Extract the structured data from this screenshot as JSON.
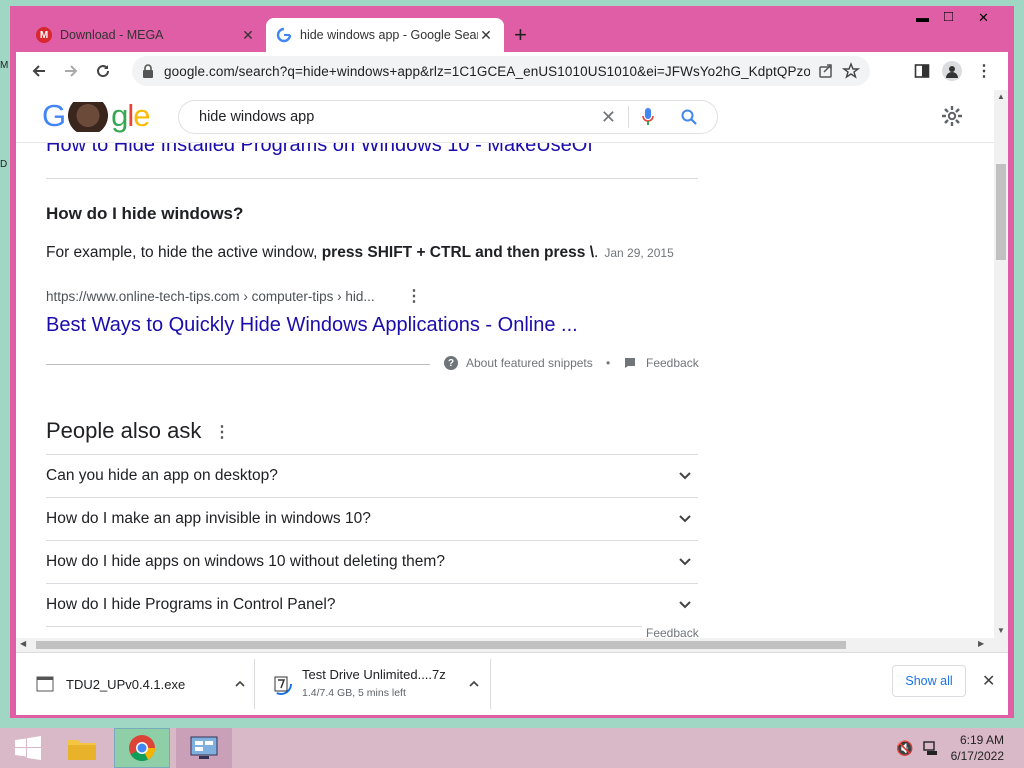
{
  "desktop": {
    "left_chars": [
      "M",
      "D"
    ]
  },
  "browser": {
    "tabs": [
      {
        "title": "Download - MEGA",
        "favicon": "mega-icon",
        "active": false
      },
      {
        "title": "hide windows app - Google Sear",
        "favicon": "google-icon",
        "active": true
      }
    ],
    "window_controls": {
      "minimize": "▬",
      "maximize": "□",
      "close": "✕"
    },
    "address": "google.com/search?q=hide+windows+app&rlz=1C1GCEA_enUS1010US1010&ei=JFWsYo2hG_KdptQPzoiC..."
  },
  "search": {
    "logo": "Google",
    "query": "hide windows app"
  },
  "results": {
    "cut_title": "How to Hide Installed Programs on Windows 10 - MakeUseOf",
    "featured": {
      "question": "How do I hide windows?",
      "snippet_start": "For example, to hide the active window, ",
      "snippet_bold": "press SHIFT + CTRL and then press \\",
      "snippet_end": ".",
      "date": "Jan 29, 2015",
      "cite": "https://www.online-tech-tips.com › computer-tips › hid...",
      "title": "Best Ways to Quickly Hide Windows Applications - Online ...",
      "about_label": "About featured snippets",
      "separator": "•",
      "feedback_label": "Feedback"
    },
    "paa": {
      "heading": "People also ask",
      "items": [
        "Can you hide an app on desktop?",
        "How do I make an app invisible in windows 10?",
        "How do I hide apps on windows 10 without deleting them?",
        "How do I hide Programs in Control Panel?"
      ],
      "feedback_label": "Feedback"
    }
  },
  "downloads": {
    "items": [
      {
        "name": "TDU2_UPv0.4.1.exe",
        "status": ""
      },
      {
        "name": "Test Drive Unlimited....7z",
        "status": "1.4/7.4 GB, 5 mins left"
      }
    ],
    "show_all": "Show all"
  },
  "taskbar": {
    "time": "6:19 AM",
    "date": "6/17/2022"
  },
  "colors": {
    "window_frame": "#e05ea6",
    "link": "#1a0dab",
    "taskbar": "#d9b8c8",
    "desktop": "#9fd6c4"
  }
}
